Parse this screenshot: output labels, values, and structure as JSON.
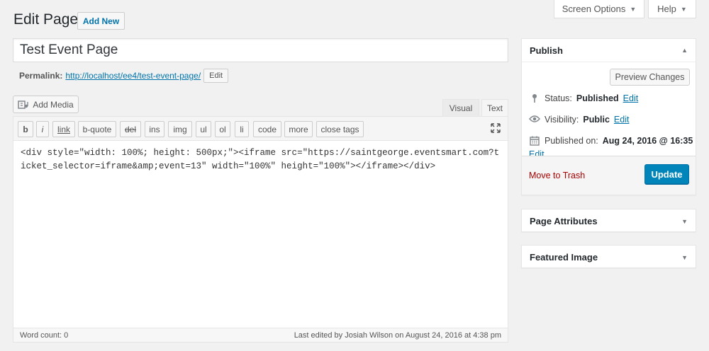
{
  "header": {
    "title": "Edit Page",
    "add_new": "Add New",
    "screen_options": "Screen Options",
    "help": "Help"
  },
  "post": {
    "title": "Test Event Page",
    "permalink_label": "Permalink:",
    "permalink_url": "http://localhost/ee4/test-event-page/",
    "permalink_edit": "Edit"
  },
  "editor": {
    "add_media": "Add Media",
    "tab_visual": "Visual",
    "tab_text": "Text",
    "quicktags": [
      "b",
      "i",
      "link",
      "b-quote",
      "del",
      "ins",
      "img",
      "ul",
      "ol",
      "li",
      "code",
      "more",
      "close tags"
    ],
    "content": "<div style=\"width: 100%; height: 500px;\"><iframe src=\"https://saintgeorge.eventsmart.com?ticket_selector=iframe&amp;event=13\" width=\"100%\" height=\"100%\"></iframe></div>",
    "word_count": "Word count: 0",
    "last_edited": "Last edited by Josiah Wilson on August 24, 2016 at 4:38 pm"
  },
  "publish": {
    "title": "Publish",
    "preview": "Preview Changes",
    "status_label": "Status:",
    "status_value": "Published",
    "visibility_label": "Visibility:",
    "visibility_value": "Public",
    "published_label": "Published on:",
    "published_value": "Aug 24, 2016 @ 16:35",
    "edit": "Edit",
    "trash": "Move to Trash",
    "update": "Update"
  },
  "sidebar": {
    "page_attributes": "Page Attributes",
    "featured_image": "Featured Image"
  },
  "colors": {
    "primary": "#0085ba",
    "link": "#0073aa",
    "trash": "#a00"
  }
}
